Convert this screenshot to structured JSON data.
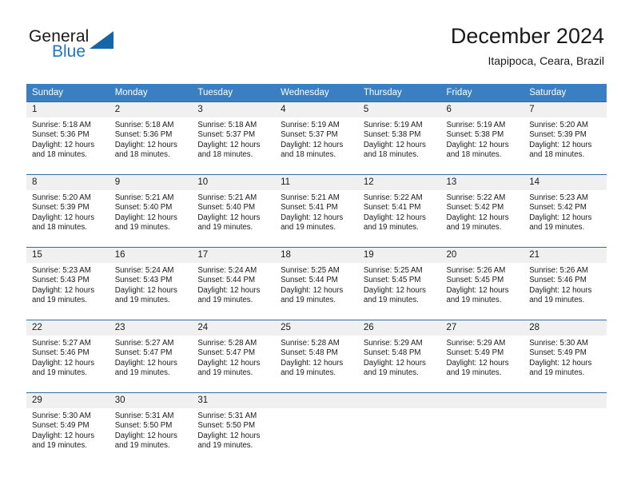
{
  "brand": {
    "name_part1": "General",
    "name_part2": "Blue",
    "accent_color": "#1f76bc",
    "triangle_color": "#1565a8"
  },
  "header": {
    "title": "December 2024",
    "subtitle": "Itapipoca, Ceara, Brazil"
  },
  "calendar": {
    "header_bg": "#3a7fc1",
    "daynum_bg": "#f0f0f0",
    "row_border": "#2f6ea8",
    "weekday_headers": [
      "Sunday",
      "Monday",
      "Tuesday",
      "Wednesday",
      "Thursday",
      "Friday",
      "Saturday"
    ],
    "weeks": [
      [
        {
          "day": "1",
          "sunrise": "Sunrise: 5:18 AM",
          "sunset": "Sunset: 5:36 PM",
          "daylight": "Daylight: 12 hours and 18 minutes."
        },
        {
          "day": "2",
          "sunrise": "Sunrise: 5:18 AM",
          "sunset": "Sunset: 5:36 PM",
          "daylight": "Daylight: 12 hours and 18 minutes."
        },
        {
          "day": "3",
          "sunrise": "Sunrise: 5:18 AM",
          "sunset": "Sunset: 5:37 PM",
          "daylight": "Daylight: 12 hours and 18 minutes."
        },
        {
          "day": "4",
          "sunrise": "Sunrise: 5:19 AM",
          "sunset": "Sunset: 5:37 PM",
          "daylight": "Daylight: 12 hours and 18 minutes."
        },
        {
          "day": "5",
          "sunrise": "Sunrise: 5:19 AM",
          "sunset": "Sunset: 5:38 PM",
          "daylight": "Daylight: 12 hours and 18 minutes."
        },
        {
          "day": "6",
          "sunrise": "Sunrise: 5:19 AM",
          "sunset": "Sunset: 5:38 PM",
          "daylight": "Daylight: 12 hours and 18 minutes."
        },
        {
          "day": "7",
          "sunrise": "Sunrise: 5:20 AM",
          "sunset": "Sunset: 5:39 PM",
          "daylight": "Daylight: 12 hours and 18 minutes."
        }
      ],
      [
        {
          "day": "8",
          "sunrise": "Sunrise: 5:20 AM",
          "sunset": "Sunset: 5:39 PM",
          "daylight": "Daylight: 12 hours and 18 minutes."
        },
        {
          "day": "9",
          "sunrise": "Sunrise: 5:21 AM",
          "sunset": "Sunset: 5:40 PM",
          "daylight": "Daylight: 12 hours and 19 minutes."
        },
        {
          "day": "10",
          "sunrise": "Sunrise: 5:21 AM",
          "sunset": "Sunset: 5:40 PM",
          "daylight": "Daylight: 12 hours and 19 minutes."
        },
        {
          "day": "11",
          "sunrise": "Sunrise: 5:21 AM",
          "sunset": "Sunset: 5:41 PM",
          "daylight": "Daylight: 12 hours and 19 minutes."
        },
        {
          "day": "12",
          "sunrise": "Sunrise: 5:22 AM",
          "sunset": "Sunset: 5:41 PM",
          "daylight": "Daylight: 12 hours and 19 minutes."
        },
        {
          "day": "13",
          "sunrise": "Sunrise: 5:22 AM",
          "sunset": "Sunset: 5:42 PM",
          "daylight": "Daylight: 12 hours and 19 minutes."
        },
        {
          "day": "14",
          "sunrise": "Sunrise: 5:23 AM",
          "sunset": "Sunset: 5:42 PM",
          "daylight": "Daylight: 12 hours and 19 minutes."
        }
      ],
      [
        {
          "day": "15",
          "sunrise": "Sunrise: 5:23 AM",
          "sunset": "Sunset: 5:43 PM",
          "daylight": "Daylight: 12 hours and 19 minutes."
        },
        {
          "day": "16",
          "sunrise": "Sunrise: 5:24 AM",
          "sunset": "Sunset: 5:43 PM",
          "daylight": "Daylight: 12 hours and 19 minutes."
        },
        {
          "day": "17",
          "sunrise": "Sunrise: 5:24 AM",
          "sunset": "Sunset: 5:44 PM",
          "daylight": "Daylight: 12 hours and 19 minutes."
        },
        {
          "day": "18",
          "sunrise": "Sunrise: 5:25 AM",
          "sunset": "Sunset: 5:44 PM",
          "daylight": "Daylight: 12 hours and 19 minutes."
        },
        {
          "day": "19",
          "sunrise": "Sunrise: 5:25 AM",
          "sunset": "Sunset: 5:45 PM",
          "daylight": "Daylight: 12 hours and 19 minutes."
        },
        {
          "day": "20",
          "sunrise": "Sunrise: 5:26 AM",
          "sunset": "Sunset: 5:45 PM",
          "daylight": "Daylight: 12 hours and 19 minutes."
        },
        {
          "day": "21",
          "sunrise": "Sunrise: 5:26 AM",
          "sunset": "Sunset: 5:46 PM",
          "daylight": "Daylight: 12 hours and 19 minutes."
        }
      ],
      [
        {
          "day": "22",
          "sunrise": "Sunrise: 5:27 AM",
          "sunset": "Sunset: 5:46 PM",
          "daylight": "Daylight: 12 hours and 19 minutes."
        },
        {
          "day": "23",
          "sunrise": "Sunrise: 5:27 AM",
          "sunset": "Sunset: 5:47 PM",
          "daylight": "Daylight: 12 hours and 19 minutes."
        },
        {
          "day": "24",
          "sunrise": "Sunrise: 5:28 AM",
          "sunset": "Sunset: 5:47 PM",
          "daylight": "Daylight: 12 hours and 19 minutes."
        },
        {
          "day": "25",
          "sunrise": "Sunrise: 5:28 AM",
          "sunset": "Sunset: 5:48 PM",
          "daylight": "Daylight: 12 hours and 19 minutes."
        },
        {
          "day": "26",
          "sunrise": "Sunrise: 5:29 AM",
          "sunset": "Sunset: 5:48 PM",
          "daylight": "Daylight: 12 hours and 19 minutes."
        },
        {
          "day": "27",
          "sunrise": "Sunrise: 5:29 AM",
          "sunset": "Sunset: 5:49 PM",
          "daylight": "Daylight: 12 hours and 19 minutes."
        },
        {
          "day": "28",
          "sunrise": "Sunrise: 5:30 AM",
          "sunset": "Sunset: 5:49 PM",
          "daylight": "Daylight: 12 hours and 19 minutes."
        }
      ],
      [
        {
          "day": "29",
          "sunrise": "Sunrise: 5:30 AM",
          "sunset": "Sunset: 5:49 PM",
          "daylight": "Daylight: 12 hours and 19 minutes."
        },
        {
          "day": "30",
          "sunrise": "Sunrise: 5:31 AM",
          "sunset": "Sunset: 5:50 PM",
          "daylight": "Daylight: 12 hours and 19 minutes."
        },
        {
          "day": "31",
          "sunrise": "Sunrise: 5:31 AM",
          "sunset": "Sunset: 5:50 PM",
          "daylight": "Daylight: 12 hours and 19 minutes."
        },
        {
          "day": "",
          "sunrise": "",
          "sunset": "",
          "daylight": ""
        },
        {
          "day": "",
          "sunrise": "",
          "sunset": "",
          "daylight": ""
        },
        {
          "day": "",
          "sunrise": "",
          "sunset": "",
          "daylight": ""
        },
        {
          "day": "",
          "sunrise": "",
          "sunset": "",
          "daylight": ""
        }
      ]
    ]
  }
}
